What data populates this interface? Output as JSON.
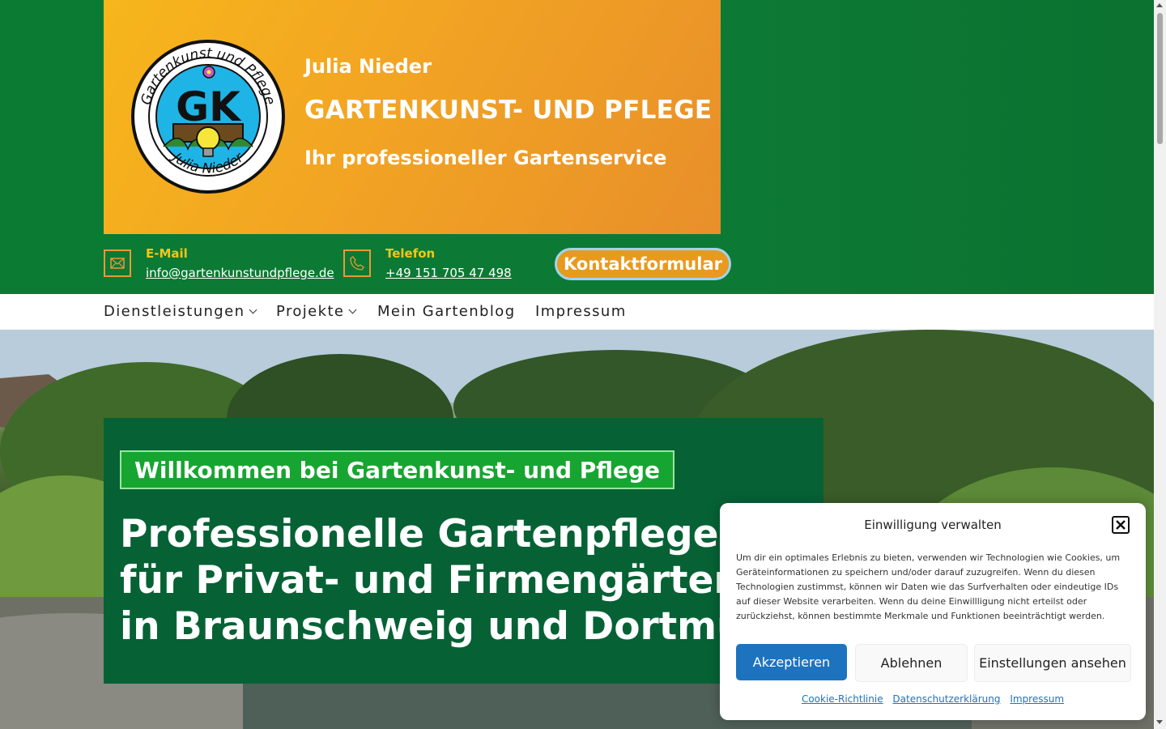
{
  "brand": {
    "logo_text_top": "Gartenkunst und Pflege",
    "logo_initials": "GK",
    "logo_text_bottom": "Julia Nieder",
    "name": "Julia Nieder",
    "title": "GARTENKUNST- UND PFLEGE",
    "tagline": "Ihr professioneller Gartenservice"
  },
  "contact": {
    "email_label": "E-Mail",
    "email_value": "info@gartenkunstundpflege.de",
    "phone_label": "Telefon",
    "phone_value": "+49 151 705 47 498",
    "cta_label": "Kontaktformular"
  },
  "nav": {
    "items": [
      {
        "label": "Dienstleistungen",
        "has_dropdown": true
      },
      {
        "label": "Projekte",
        "has_dropdown": true
      },
      {
        "label": "Mein Gartenblog",
        "has_dropdown": false
      },
      {
        "label": "Impressum",
        "has_dropdown": false
      }
    ]
  },
  "hero": {
    "badge": "Willkommen bei Gartenkunst- und Pflege",
    "heading_lines": [
      "Professionelle Gartenpflege",
      "für Privat- und Firmengärten",
      "in Braunschweig und Dortmund"
    ]
  },
  "cookie": {
    "title": "Einwilligung verwalten",
    "text": "Um dir ein optimales Erlebnis zu bieten, verwenden wir Technologien wie Cookies, um Geräteinformationen zu speichern und/oder darauf zuzugreifen. Wenn du diesen Technologien zustimmst, können wir Daten wie das Surfverhalten oder eindeutige IDs auf dieser Website verarbeiten. Wenn du deine Einwillligung nicht erteilst oder zurückziehst, können bestimmte Merkmale und Funktionen beeinträchtigt werden.",
    "accept_label": "Akzeptieren",
    "deny_label": "Ablehnen",
    "settings_label": "Einstellungen ansehen",
    "links": [
      "Cookie-Richtlinie",
      "Datenschutzerklärung",
      "Impressum"
    ]
  },
  "colors": {
    "header_green": "#0b7a33",
    "brand_orange": "#f2a423",
    "hero_box_green": "#066235",
    "badge_green": "#17a531",
    "accept_blue": "#1e73be",
    "label_yellow": "#f5c518"
  }
}
